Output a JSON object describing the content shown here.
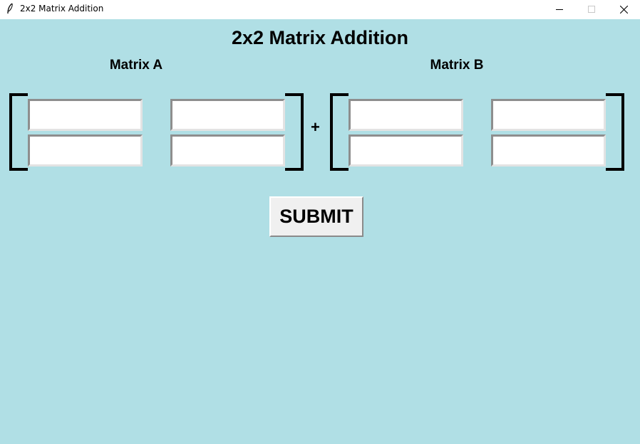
{
  "window": {
    "title": "2x2 Matrix Addition",
    "background": "#b0dfe5",
    "icon": "feather-icon",
    "controls": [
      "minimize-icon",
      "maximize-icon",
      "close-icon"
    ]
  },
  "heading": "2x2 Matrix Addition",
  "matrix_a": {
    "label": "Matrix A",
    "cells": [
      "",
      "",
      "",
      ""
    ]
  },
  "operator": "+",
  "matrix_b": {
    "label": "Matrix B",
    "cells": [
      "",
      "",
      "",
      ""
    ]
  },
  "submit_label": "SUBMIT"
}
